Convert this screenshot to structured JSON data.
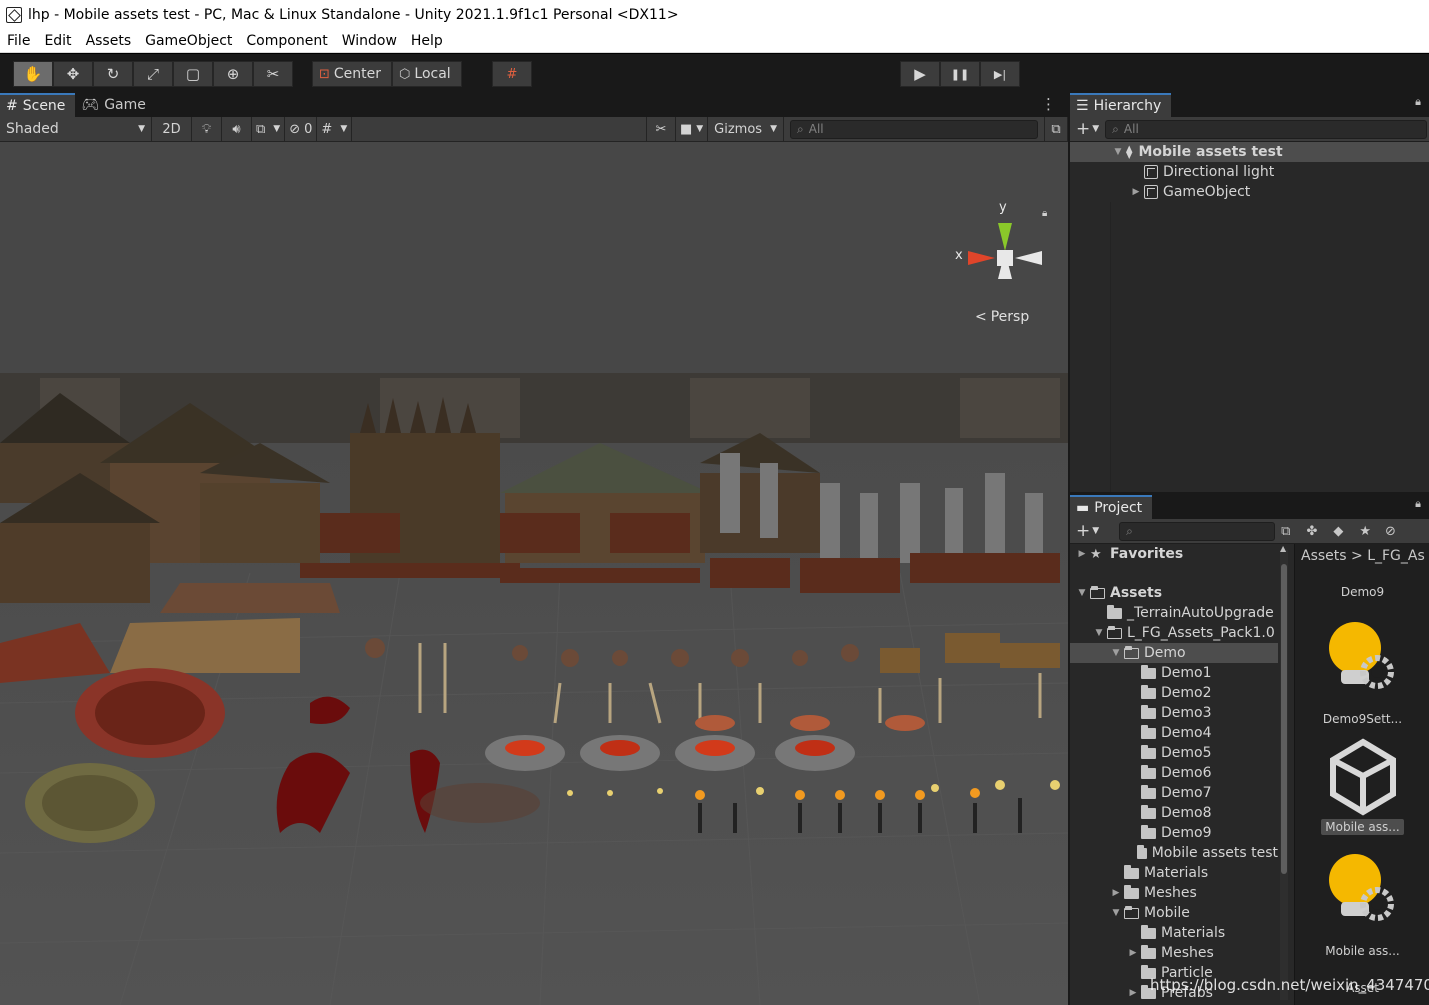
{
  "window": {
    "title": "lhp - Mobile assets test - PC, Mac & Linux Standalone - Unity 2021.1.9f1c1 Personal <DX11>"
  },
  "menu": [
    "File",
    "Edit",
    "Assets",
    "GameObject",
    "Component",
    "Window",
    "Help"
  ],
  "toolbar": {
    "tools": [
      {
        "name": "hand-tool",
        "glyph": "✋"
      },
      {
        "name": "move-tool",
        "glyph": "✥"
      },
      {
        "name": "rotate-tool",
        "glyph": "↻"
      },
      {
        "name": "scale-tool",
        "glyph": "⤢"
      },
      {
        "name": "rect-tool",
        "glyph": "▢"
      },
      {
        "name": "transform-tool",
        "glyph": "⊕"
      },
      {
        "name": "custom-tool",
        "glyph": "✂"
      }
    ],
    "pivot": "Center",
    "space": "Local",
    "play": "▶",
    "pause": "❚❚",
    "step": "▶|"
  },
  "scene": {
    "tabs": [
      "Scene",
      "Game"
    ],
    "shading": "Shaded",
    "mode2d": "2D",
    "hidden_count": "0",
    "gizmos": "Gizmos",
    "search_placeholder": "All",
    "gizmo_labels": {
      "y": "y",
      "x": "x"
    },
    "persp": "Persp"
  },
  "hierarchy": {
    "tab": "Hierarchy",
    "search_placeholder": "All",
    "scene_name": "Mobile assets test",
    "items": [
      "Directional light",
      "GameObject"
    ]
  },
  "project": {
    "tab": "Project",
    "favorites": "Favorites",
    "tree": [
      {
        "label": "Assets",
        "depth": 0,
        "open": true,
        "bold": true
      },
      {
        "label": "_TerrainAutoUpgrade",
        "depth": 1,
        "open": false
      },
      {
        "label": "L_FG_Assets_Pack1.0",
        "depth": 1,
        "open": true
      },
      {
        "label": "Demo",
        "depth": 2,
        "open": true,
        "selected": true
      },
      {
        "label": "Demo1",
        "depth": 3
      },
      {
        "label": "Demo2",
        "depth": 3
      },
      {
        "label": "Demo3",
        "depth": 3
      },
      {
        "label": "Demo4",
        "depth": 3
      },
      {
        "label": "Demo5",
        "depth": 3
      },
      {
        "label": "Demo6",
        "depth": 3
      },
      {
        "label": "Demo7",
        "depth": 3
      },
      {
        "label": "Demo8",
        "depth": 3
      },
      {
        "label": "Demo9",
        "depth": 3
      },
      {
        "label": "Mobile assets test",
        "depth": 3
      },
      {
        "label": "Materials",
        "depth": 2
      },
      {
        "label": "Meshes",
        "depth": 2,
        "collapsed": true
      },
      {
        "label": "Mobile",
        "depth": 2,
        "open": true
      },
      {
        "label": "Materials",
        "depth": 3
      },
      {
        "label": "Meshes",
        "depth": 3,
        "collapsed": true
      },
      {
        "label": "Particle",
        "depth": 3
      },
      {
        "label": "Prefabs",
        "depth": 3,
        "collapsed": true
      }
    ],
    "breadcrumb": "Assets > L_FG_As",
    "assets": [
      "Demo9",
      "Demo9Sett...",
      "Mobile ass...",
      "Mobile ass...",
      "Asset"
    ]
  },
  "watermark": "https://blog.csdn.net/weixin_43474701",
  "colors": {
    "accent": "#3a79bb",
    "panel": "#282828",
    "toolbar": "#3c3c3c"
  }
}
